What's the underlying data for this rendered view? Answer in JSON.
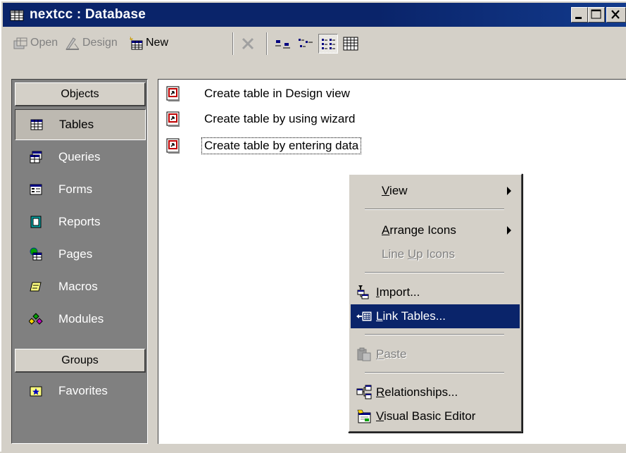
{
  "window": {
    "title": "nextcc : Database",
    "minimize_label": "Minimize",
    "maximize_label": "Maximize",
    "close_label": "Close"
  },
  "toolbar": {
    "open_label": "Open",
    "design_label": "Design",
    "new_label": "New",
    "delete_icon": "delete-x-icon",
    "view_buttons": [
      "large-icons",
      "small-icons",
      "list",
      "details"
    ],
    "pressed_view": "list"
  },
  "objects_bar": {
    "objects_header": "Objects",
    "items": [
      {
        "label": "Tables",
        "icon": "table-icon",
        "selected": true
      },
      {
        "label": "Queries",
        "icon": "query-icon",
        "selected": false
      },
      {
        "label": "Forms",
        "icon": "form-icon",
        "selected": false
      },
      {
        "label": "Reports",
        "icon": "report-icon",
        "selected": false
      },
      {
        "label": "Pages",
        "icon": "page-icon",
        "selected": false
      },
      {
        "label": "Macros",
        "icon": "macro-icon",
        "selected": false
      },
      {
        "label": "Modules",
        "icon": "module-icon",
        "selected": false
      }
    ],
    "groups_header": "Groups",
    "groups": [
      {
        "label": "Favorites",
        "icon": "favorites-icon"
      }
    ]
  },
  "list": {
    "items": [
      {
        "label": "Create table in Design view",
        "icon": "shortcut-icon"
      },
      {
        "label": "Create table by using wizard",
        "icon": "shortcut-icon"
      },
      {
        "label": "Create table by entering data",
        "icon": "shortcut-icon",
        "focused": true
      }
    ]
  },
  "context_menu": {
    "view": "View",
    "arrange_icons": "Arrange Icons",
    "line_up_icons": "Line Up Icons",
    "import": "Import...",
    "link_tables": "Link Tables...",
    "paste": "Paste",
    "relationships": "Relationships...",
    "visual_basic_editor": "Visual Basic Editor",
    "highlighted": "Link Tables..."
  },
  "colors": {
    "titlebar": "#0a246a",
    "face": "#d4d0c8",
    "objects_bar": "#808080",
    "highlight": "#0a246a"
  }
}
